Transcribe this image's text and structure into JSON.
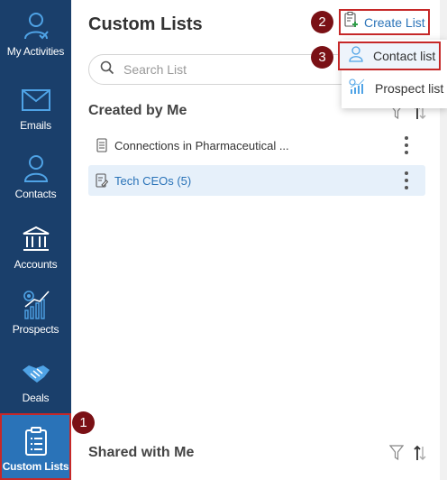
{
  "sidebar": {
    "items": [
      {
        "label": "My Activities",
        "icon": "my-activities-icon"
      },
      {
        "label": "Emails",
        "icon": "email-icon"
      },
      {
        "label": "Contacts",
        "icon": "contact-icon"
      },
      {
        "label": "Accounts",
        "icon": "bank-icon"
      },
      {
        "label": "Prospects",
        "icon": "prospects-chart-icon"
      },
      {
        "label": "Deals",
        "icon": "handshake-icon"
      },
      {
        "label": "Custom Lists",
        "icon": "custom-list-icon",
        "active": true
      }
    ]
  },
  "header": {
    "title": "Custom Lists",
    "create_label": "Create List"
  },
  "search": {
    "placeholder": "Search List"
  },
  "dropdown": {
    "items": [
      {
        "label": "Contact list"
      },
      {
        "label": "Prospect list"
      }
    ]
  },
  "sections": {
    "created": {
      "title": "Created by Me",
      "rows": [
        {
          "label": "Connections in Pharmaceutical ..."
        },
        {
          "label": "Tech CEOs (5)",
          "selected": true
        }
      ]
    },
    "shared": {
      "title": "Shared with Me"
    }
  },
  "callouts": [
    "1",
    "2",
    "3"
  ],
  "colors": {
    "sidebar_bg": "#1a3f6b",
    "sidebar_active": "#2a73b8",
    "accent": "#2a73b8",
    "highlight_outline": "#c62828",
    "callout": "#7a1015"
  }
}
